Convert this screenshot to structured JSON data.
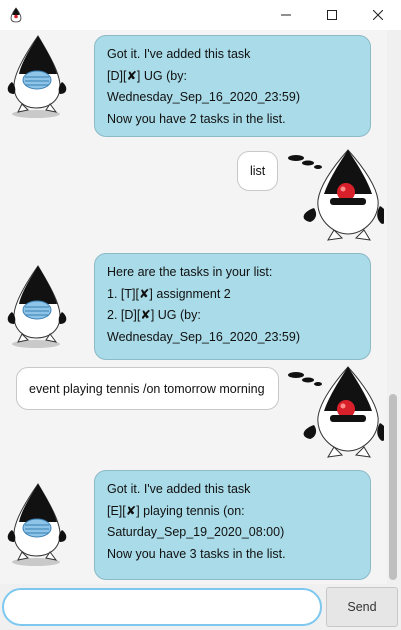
{
  "window": {
    "icons": {
      "app": "duke-app-icon",
      "minimize": "minimize-icon",
      "maximize": "maximize-icon",
      "close": "close-icon"
    }
  },
  "messages": [
    {
      "sender": "bot",
      "lines": [
        "Got it. I've added this task",
        "[D][✘] UG (by:",
        "Wednesday_Sep_16_2020_23:59)",
        "Now you have 2 tasks in the list."
      ]
    },
    {
      "sender": "user",
      "text": "list"
    },
    {
      "sender": "bot",
      "lines": [
        "Here are the tasks in your list:",
        "1. [T][✘] assignment 2",
        "2. [D][✘] UG (by:",
        "Wednesday_Sep_16_2020_23:59)"
      ]
    },
    {
      "sender": "user",
      "text": "event playing tennis /on tomorrow morning"
    },
    {
      "sender": "bot",
      "lines": [
        "Got it. I've added this task",
        "[E][✘] playing tennis (on:",
        "Saturday_Sep_19_2020_08:00)",
        "Now you have 3 tasks in the list."
      ]
    }
  ],
  "input": {
    "value": "",
    "placeholder": ""
  },
  "send_button": {
    "label": "Send"
  }
}
